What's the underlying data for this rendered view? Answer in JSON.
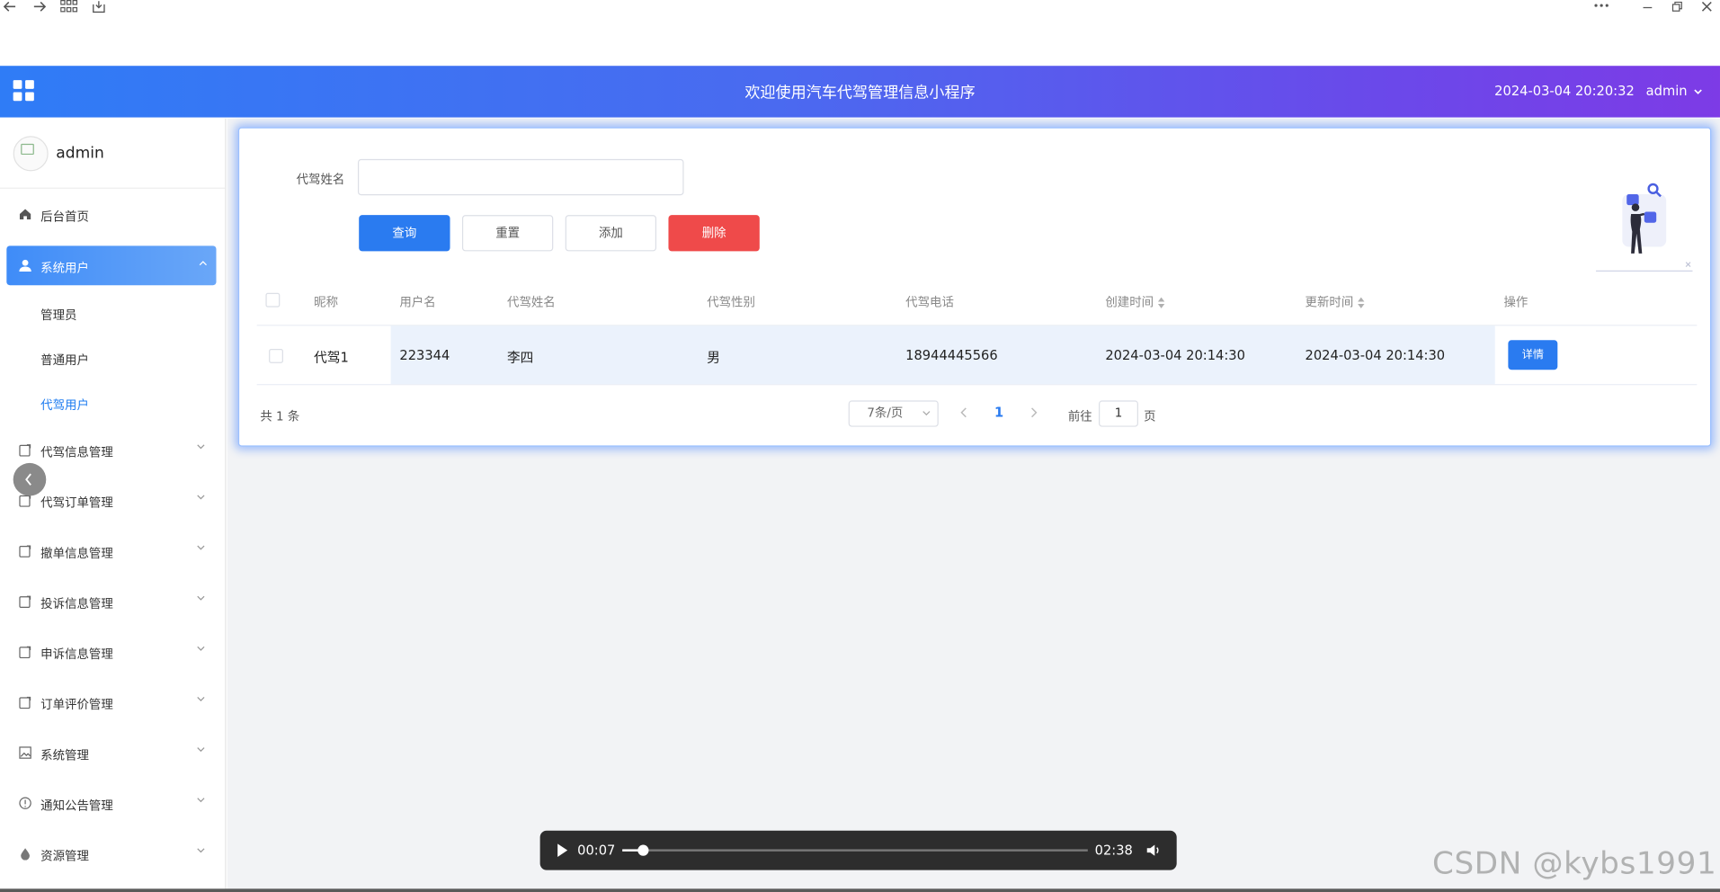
{
  "header": {
    "title": "欢迎使用汽车代驾管理信息小程序",
    "datetime": "2024-03-04 20:20:32",
    "user": "admin"
  },
  "sidebar": {
    "username": "admin",
    "items": [
      {
        "label": "后台首页",
        "icon": "home-icon"
      },
      {
        "label": "系统用户",
        "icon": "user-icon",
        "active": true,
        "children": [
          "管理员",
          "普通用户",
          "代驾用户"
        ],
        "current_child": "代驾用户"
      },
      {
        "label": "代驾信息管理",
        "icon": "clipboard-icon"
      },
      {
        "label": "代驾订单管理",
        "icon": "clipboard-icon"
      },
      {
        "label": "撤单信息管理",
        "icon": "clipboard-icon"
      },
      {
        "label": "投诉信息管理",
        "icon": "clipboard-icon"
      },
      {
        "label": "申诉信息管理",
        "icon": "clipboard-icon"
      },
      {
        "label": "订单评价管理",
        "icon": "clipboard-icon"
      },
      {
        "label": "系统管理",
        "icon": "picture-icon"
      },
      {
        "label": "通知公告管理",
        "icon": "info-icon"
      },
      {
        "label": "资源管理",
        "icon": "drop-icon"
      }
    ]
  },
  "search": {
    "label": "代驾姓名",
    "value": "",
    "placeholder": ""
  },
  "toolbar": {
    "query": "查询",
    "reset": "重置",
    "add": "添加",
    "delete": "删除"
  },
  "table": {
    "columns": [
      "昵称",
      "用户名",
      "代驾姓名",
      "代驾性别",
      "代驾电话",
      "创建时间",
      "更新时间",
      "操作"
    ],
    "rows": [
      {
        "nickname": "代驾1",
        "username": "223344",
        "name": "李四",
        "gender": "男",
        "phone": "18944445566",
        "created": "2024-03-04 20:14:30",
        "updated": "2024-03-04 20:14:30",
        "action": "详情"
      }
    ]
  },
  "pagination": {
    "total": "共 1 条",
    "page_size": "7条/页",
    "current_page": "1",
    "goto_prefix": "前往",
    "goto_value": "1",
    "goto_suffix": "页"
  },
  "video": {
    "current": "00:07",
    "duration": "02:38",
    "progress": 0.044
  },
  "watermark": "CSDN @kybs1991",
  "colors": {
    "primary": "#2a7bf0",
    "danger": "#ef4a4a",
    "header_start": "#2f7cf6",
    "header_end": "#7d3be6"
  }
}
